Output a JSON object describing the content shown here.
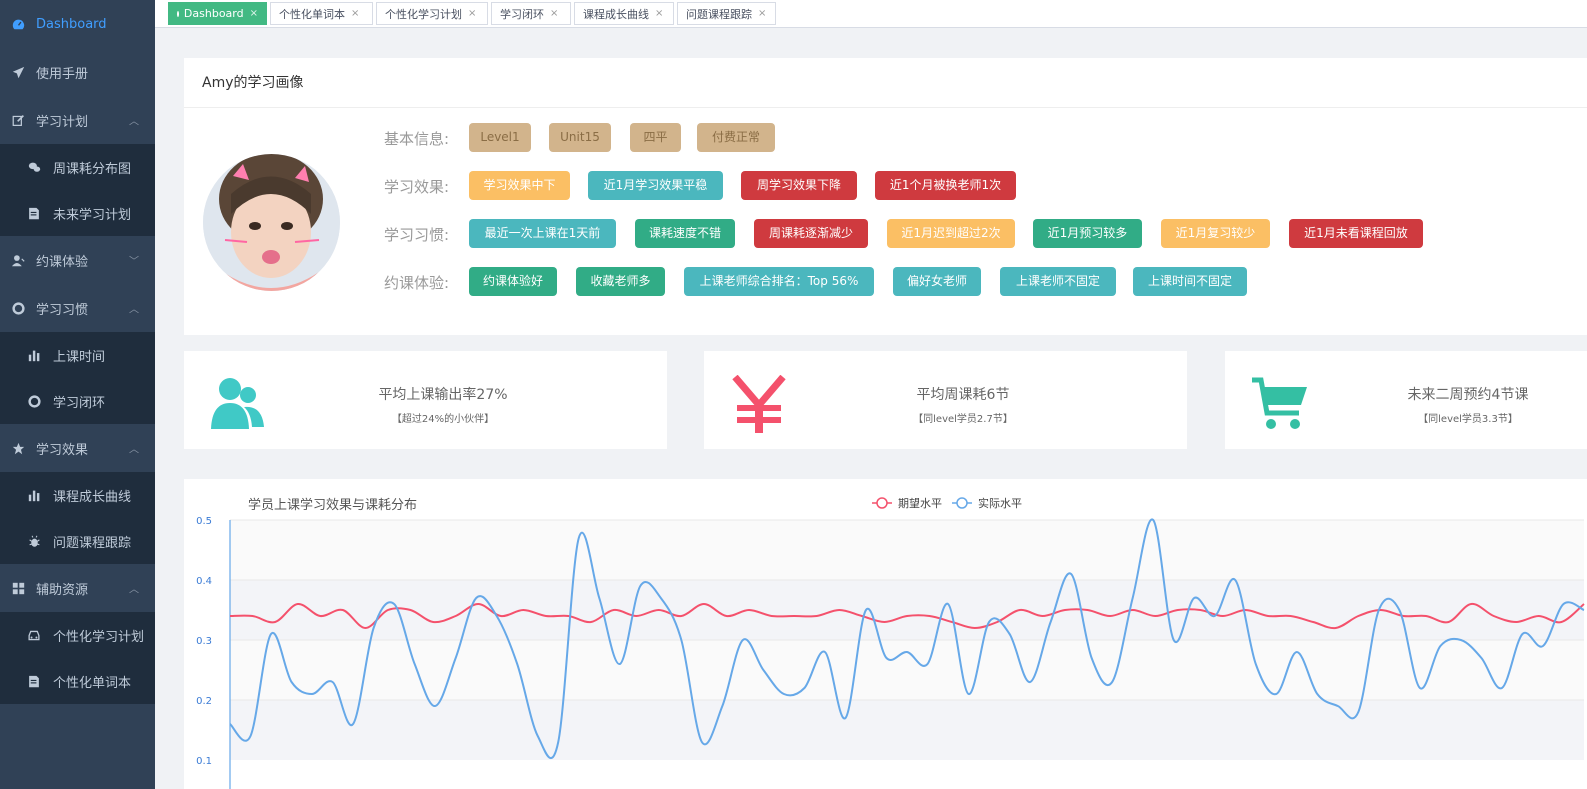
{
  "sidebar": {
    "items": [
      {
        "label": "Dashboard",
        "icon": "dashboard-icon",
        "active": true
      },
      {
        "label": "使用手册",
        "icon": "paper-plane-icon"
      },
      {
        "label": "学习计划",
        "icon": "edit-icon",
        "expanded": true,
        "children": [
          {
            "label": "周课耗分布图",
            "icon": "chat-icon"
          },
          {
            "label": "未来学习计划",
            "icon": "document-icon"
          }
        ]
      },
      {
        "label": "约课体验",
        "icon": "user-icon",
        "expanded": false
      },
      {
        "label": "学习习惯",
        "icon": "lifebuoy-icon",
        "expanded": true,
        "children": [
          {
            "label": "上课时间",
            "icon": "bar-chart-icon"
          },
          {
            "label": "学习闭环",
            "icon": "lifebuoy-icon"
          }
        ]
      },
      {
        "label": "学习效果",
        "icon": "star-icon",
        "expanded": true,
        "children": [
          {
            "label": "课程成长曲线",
            "icon": "bar-chart-icon"
          },
          {
            "label": "问题课程跟踪",
            "icon": "bug-icon"
          }
        ]
      },
      {
        "label": "辅助资源",
        "icon": "grid-icon",
        "expanded": true,
        "children": [
          {
            "label": "个性化学习计划",
            "icon": "car-icon"
          },
          {
            "label": "个性化单词本",
            "icon": "document-icon"
          }
        ]
      }
    ]
  },
  "tags": [
    {
      "label": "Dashboard",
      "active": true
    },
    {
      "label": "个性化单词本"
    },
    {
      "label": "个性化学习计划"
    },
    {
      "label": "学习闭环"
    },
    {
      "label": "课程成长曲线"
    },
    {
      "label": "问题课程跟踪"
    }
  ],
  "profile": {
    "title": "Amy的学习画像",
    "rows": [
      {
        "label": "基本信息:",
        "badges": [
          {
            "text": "Level1",
            "color": "tan"
          },
          {
            "text": "Unit15",
            "color": "tan"
          },
          {
            "text": "四平",
            "color": "tan"
          },
          {
            "text": "付费正常",
            "color": "tan"
          }
        ]
      },
      {
        "label": "学习效果:",
        "badges": [
          {
            "text": "学习效果中下",
            "color": "orange"
          },
          {
            "text": "近1月学习效果平稳",
            "color": "teal"
          },
          {
            "text": "周学习效果下降",
            "color": "red"
          },
          {
            "text": "近1个月被换老师1次",
            "color": "red"
          }
        ]
      },
      {
        "label": "学习习惯:",
        "badges": [
          {
            "text": "最近一次上课在1天前",
            "color": "teal"
          },
          {
            "text": "课耗速度不错",
            "color": "green"
          },
          {
            "text": "周课耗逐渐减少",
            "color": "red"
          },
          {
            "text": "近1月迟到超过2次",
            "color": "orange"
          },
          {
            "text": "近1月预习较多",
            "color": "green"
          },
          {
            "text": "近1月复习较少",
            "color": "orange"
          },
          {
            "text": "近1月未看课程回放",
            "color": "red"
          }
        ]
      },
      {
        "label": "约课体验:",
        "badges": [
          {
            "text": "约课体验好",
            "color": "green"
          },
          {
            "text": "收藏老师多",
            "color": "green"
          },
          {
            "text": "上课老师综合排名：Top 56%",
            "color": "teal"
          },
          {
            "text": "偏好女老师",
            "color": "teal"
          },
          {
            "text": "上课老师不固定",
            "color": "teal"
          },
          {
            "text": "上课时间不固定",
            "color": "teal"
          }
        ]
      }
    ]
  },
  "stats": [
    {
      "main": "平均上课输出率27%",
      "sub": "【超过24%的小伙伴】",
      "icon": "people-icon",
      "color": "#40c9c6"
    },
    {
      "main": "平均周课耗6节",
      "sub": "【同level学员2.7节】",
      "icon": "yen-icon",
      "color": "#f4516c"
    },
    {
      "main": "未来二周预约4节课",
      "sub": "【同level学员3.3节】",
      "icon": "cart-icon",
      "color": "#34bfa3"
    }
  ],
  "chart_data": {
    "type": "line",
    "title": "学员上课学习效果与课耗分布",
    "legend_position": "top-center",
    "ylim": [
      0.1,
      0.5
    ],
    "yticks": [
      "0.5",
      "0.4",
      "0.3",
      "0.2",
      "0.1"
    ],
    "grid": true,
    "series": [
      {
        "name": "期望水平",
        "color": "#f4516c",
        "values": [
          0.34,
          0.34,
          0.33,
          0.36,
          0.34,
          0.35,
          0.32,
          0.35,
          0.35,
          0.33,
          0.34,
          0.36,
          0.34,
          0.35,
          0.34,
          0.34,
          0.33,
          0.35,
          0.34,
          0.35,
          0.34,
          0.36,
          0.34,
          0.35,
          0.34,
          0.34,
          0.34,
          0.35,
          0.34,
          0.33,
          0.34,
          0.34,
          0.33,
          0.32,
          0.33,
          0.35,
          0.34,
          0.35,
          0.35,
          0.34,
          0.35,
          0.34,
          0.35,
          0.35,
          0.34,
          0.35,
          0.34,
          0.34,
          0.33,
          0.32,
          0.34,
          0.35,
          0.34,
          0.34,
          0.33,
          0.36,
          0.34,
          0.33,
          0.34,
          0.33,
          0.36
        ]
      },
      {
        "name": "实际水平",
        "color": "#66a8e8",
        "values": [
          0.16,
          0.14,
          0.31,
          0.23,
          0.21,
          0.23,
          0.16,
          0.32,
          0.36,
          0.26,
          0.19,
          0.27,
          0.37,
          0.34,
          0.26,
          0.14,
          0.13,
          0.47,
          0.37,
          0.26,
          0.39,
          0.37,
          0.3,
          0.13,
          0.19,
          0.3,
          0.25,
          0.21,
          0.22,
          0.28,
          0.17,
          0.35,
          0.27,
          0.28,
          0.26,
          0.36,
          0.21,
          0.33,
          0.31,
          0.23,
          0.33,
          0.41,
          0.27,
          0.23,
          0.37,
          0.5,
          0.3,
          0.37,
          0.34,
          0.4,
          0.26,
          0.21,
          0.28,
          0.21,
          0.19,
          0.18,
          0.35,
          0.35,
          0.22,
          0.29,
          0.3,
          0.27,
          0.22,
          0.31,
          0.29,
          0.36,
          0.35
        ]
      }
    ]
  }
}
